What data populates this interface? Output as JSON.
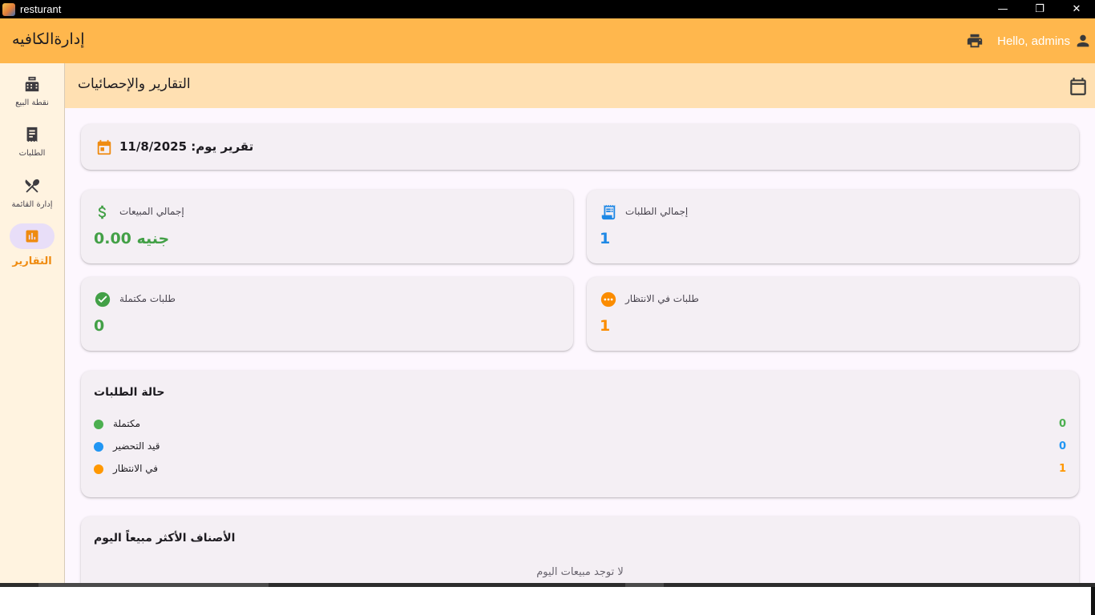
{
  "window": {
    "title": "resturant",
    "controls": {
      "minimize": "—",
      "restore": "❐",
      "close": "✕"
    }
  },
  "appbar": {
    "title": "إدارةالكافيه",
    "greeting": "Hello, admins"
  },
  "rail": {
    "items": [
      {
        "label": "نقطة البيع",
        "icon": "point-of-sale-icon"
      },
      {
        "label": "الطلبات",
        "icon": "receipt-icon"
      },
      {
        "label": "إدارة القائمة",
        "icon": "restaurant-menu-icon"
      },
      {
        "label": "التقارير",
        "icon": "bar-chart-icon",
        "active": true
      }
    ]
  },
  "header": {
    "title": "التقارير والإحصائيات"
  },
  "report": {
    "date_label": "تقرير يوم: 11/8/2025",
    "stats": {
      "total_sales": {
        "label": "إجمالي المبيعات",
        "value": "0.00 جنيه",
        "color": "#43a047"
      },
      "total_orders": {
        "label": "إجمالي الطلبات",
        "value": "1",
        "color": "#1e88e5"
      },
      "completed_orders": {
        "label": "طلبات مكتملة",
        "value": "0",
        "color": "#43a047"
      },
      "pending_orders": {
        "label": "طلبات في الانتظار",
        "value": "1",
        "color": "#fb8c00"
      }
    },
    "order_status": {
      "title": "حالة الطلبات",
      "rows": [
        {
          "label": "مكتملة",
          "count": "0",
          "color": "#4caf50"
        },
        {
          "label": "قيد التحضير",
          "count": "0",
          "color": "#2196f3"
        },
        {
          "label": "في الانتظار",
          "count": "1",
          "color": "#ff9800"
        }
      ]
    },
    "top_items": {
      "title": "الأصناف الأكثر مبيعاً اليوم",
      "empty_text": "لا توجد مبيعات اليوم"
    }
  },
  "colors": {
    "appbar": "#ffb74d",
    "header": "#ffe0b2",
    "rail": "#fff3e0",
    "accent": "#ef8b10"
  }
}
